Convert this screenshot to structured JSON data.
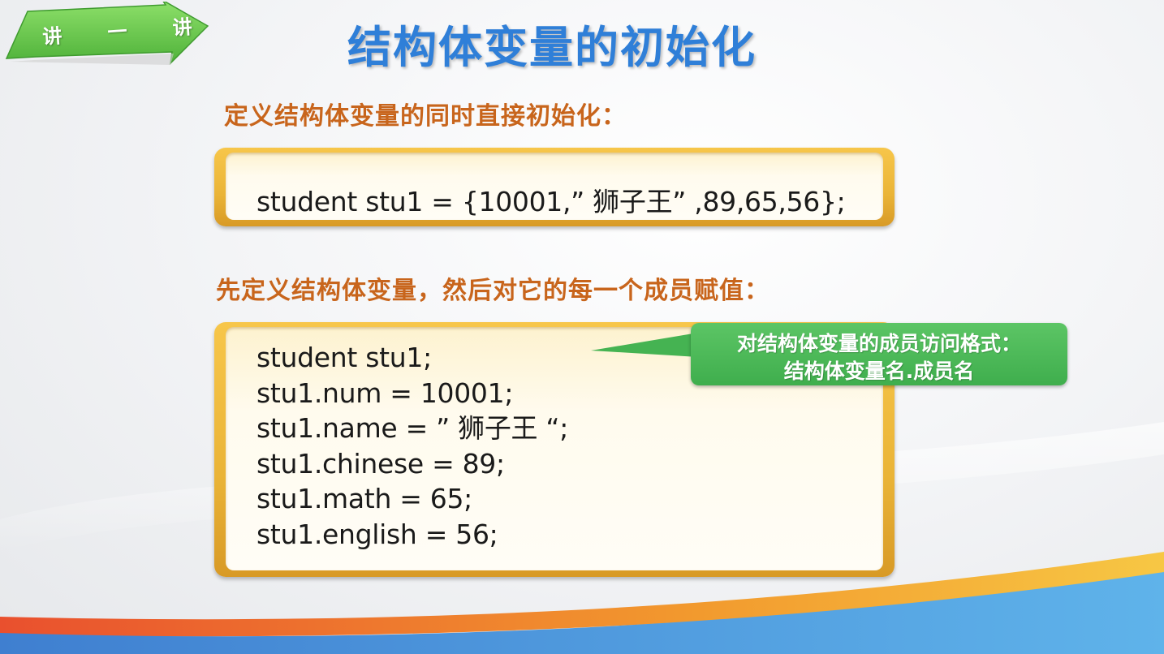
{
  "badge": {
    "label": "讲 一 讲"
  },
  "title": "结构体变量的初始化",
  "section1": {
    "heading": "定义结构体变量的同时直接初始化：",
    "code": "student stu1 = {10001,” 狮子王” ,89,65,56};"
  },
  "section2": {
    "heading": "先定义结构体变量，然后对它的每一个成员赋值：",
    "code_lines": [
      "student stu1;",
      "stu1.num = 10001;",
      "stu1.name = ” 狮子王 “;",
      "stu1.chinese = 89;",
      "stu1.math = 65;",
      "stu1.english = 56;"
    ]
  },
  "callout": {
    "line1": "对结构体变量的成员访问格式：",
    "line2": "结构体变量名.成员名"
  },
  "colors": {
    "title": "#2f7fd8",
    "heading": "#c8651c",
    "frame": "#eab437",
    "callout": "#44b351",
    "badge": "#5ec24a"
  }
}
